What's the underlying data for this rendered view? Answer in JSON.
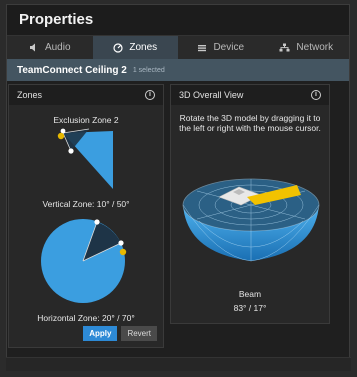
{
  "window": {
    "title": "Properties"
  },
  "tabs": [
    {
      "label": "Audio",
      "icon": "speaker-icon"
    },
    {
      "label": "Zones",
      "icon": "zones-icon",
      "active": true
    },
    {
      "label": "Device",
      "icon": "device-icon"
    },
    {
      "label": "Network",
      "icon": "network-icon"
    }
  ],
  "device": {
    "name": "TeamConnect Ceiling 2",
    "selected": "1 selected"
  },
  "zones_panel": {
    "title": "Zones",
    "exclusion_title": "Exclusion Zone 2",
    "vertical_label": "Vertical Zone: 10° / 50°",
    "horizontal_label": "Horizontal Zone: 20° / 70°",
    "apply_label": "Apply",
    "revert_label": "Revert"
  },
  "view_panel": {
    "title": "3D Overall View",
    "hint": "Rotate the 3D model by dragging it to the left or right with the mouse cursor.",
    "beam_label": "Beam",
    "beam_value": "83° / 17°"
  },
  "colors": {
    "accent": "#2d8ad6",
    "zone_fill": "#3b9ee0",
    "handle": "#e6b800",
    "beam": "#f2c200"
  }
}
